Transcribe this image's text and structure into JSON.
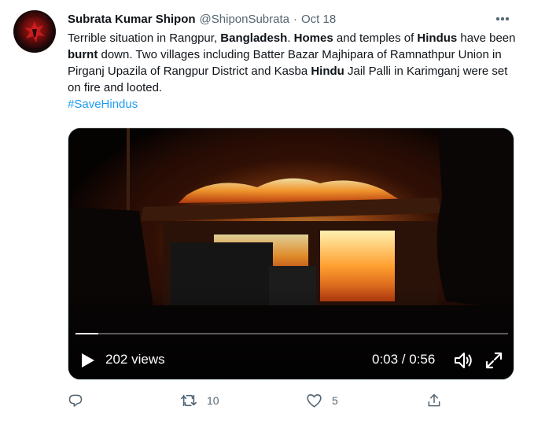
{
  "tweet": {
    "author_name": "Subrata Kumar Shipon",
    "handle": "@ShiponSubrata",
    "separator": "·",
    "date": "Oct 18",
    "text_parts": {
      "p1": "Terrible situation in Rangpur, ",
      "b1": "Bangladesh",
      "p2": ". ",
      "b2": "Homes",
      "p3": " and temples of ",
      "b3": "Hindus",
      "p4": " have been ",
      "b4": "burnt",
      "p5": " down. Two villages including Batter Bazar Majhipara of Ramnathpur Union in Pirganj Upazila of Rangpur District and Kasba ",
      "b5": "Hindu",
      "p6": " Jail Palli in Karimganj were set on fire and looted."
    },
    "hashtag": "#SaveHindus"
  },
  "video": {
    "views_label": "202 views",
    "time_label": "0:03 / 0:56",
    "progress_fraction": 0.0536
  },
  "actions": {
    "reply_count": "",
    "retweet_count": "10",
    "like_count": "5",
    "share_count": ""
  },
  "icons": {
    "avatar": "avatar-image",
    "more": "more-icon",
    "play": "play-icon",
    "volume": "volume-icon",
    "fullscreen": "fullscreen-icon",
    "reply": "reply-icon",
    "retweet": "retweet-icon",
    "like": "like-icon",
    "share": "share-icon"
  },
  "colors": {
    "text": "#0f1419",
    "secondary": "#536471",
    "link": "#1d9bf0"
  }
}
